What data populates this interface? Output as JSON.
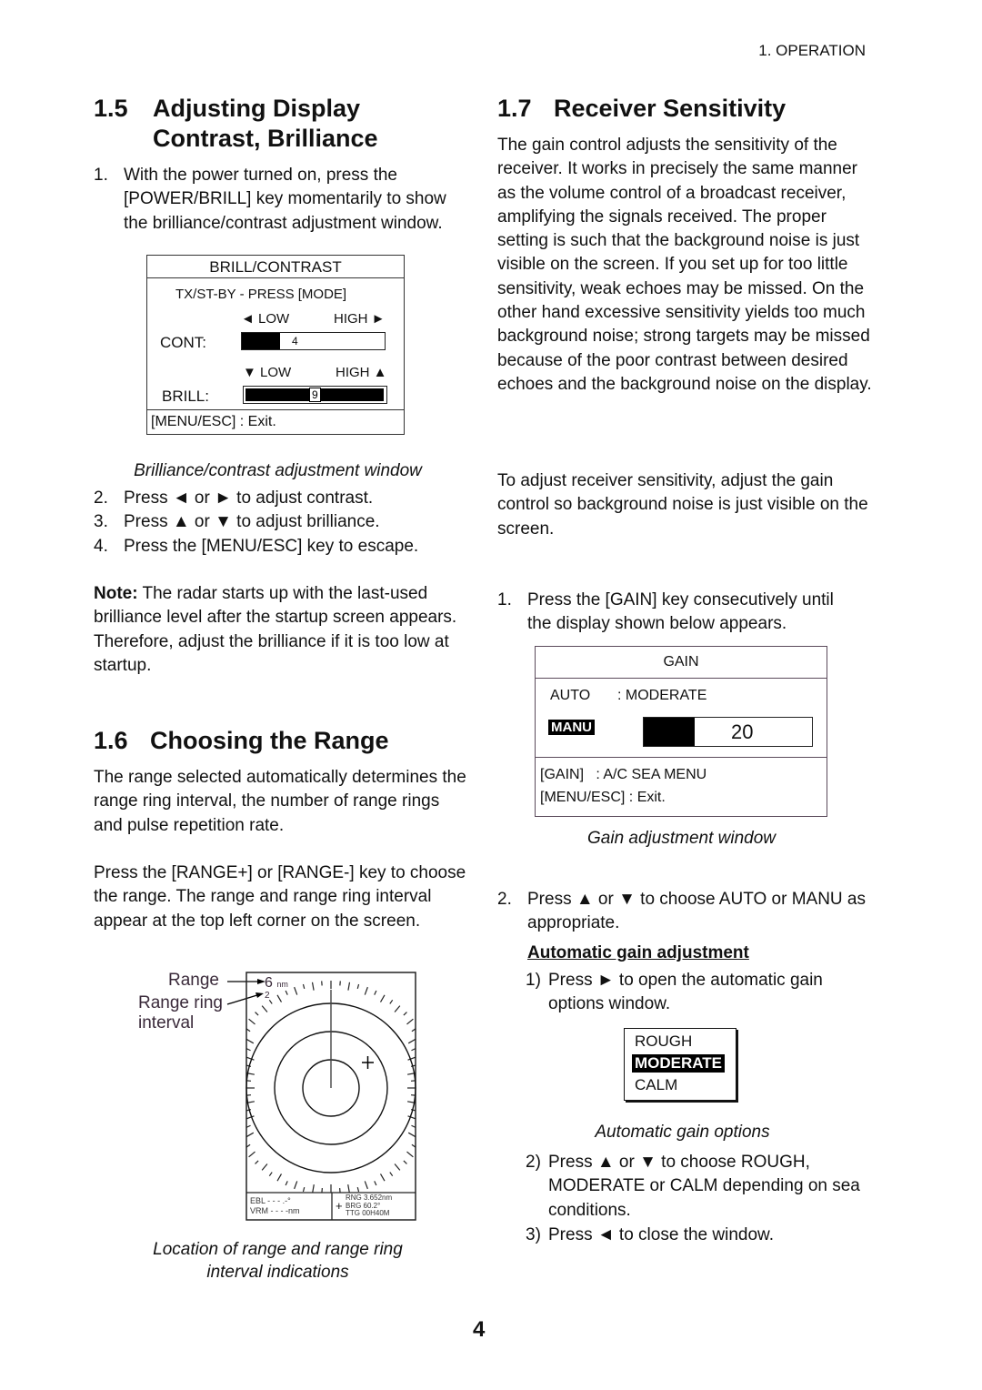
{
  "header": {
    "chapter": "1. OPERATION"
  },
  "page_number": "4",
  "s15": {
    "num": "1.5",
    "title_l1": "Adjusting Display",
    "title_l2": "Contrast, Brilliance",
    "step1": {
      "n": "1.",
      "text": "With the power turned on, press the [POWER/BRILL] key momentarily to show the brilliance/contrast adjustment window."
    },
    "window": {
      "title": "BRILL/CONTRAST",
      "status": "TX/ST-BY - PRESS [MODE]",
      "cont_low": "◄ LOW",
      "cont_high": "HIGH ►",
      "cont_label": "CONT:",
      "cont_value": "4",
      "cont_fraction": 0.27,
      "brill_low": "▼ LOW",
      "brill_high": "HIGH ▲",
      "brill_label": "BRILL:",
      "brill_value": "9",
      "brill_fraction": 1.0,
      "footer": "[MENU/ESC] : Exit."
    },
    "caption": "Brilliance/contrast adjustment window",
    "steps": [
      {
        "n": "2.",
        "text": "Press ◄ or ► to adjust contrast."
      },
      {
        "n": "3.",
        "text": "Press ▲ or ▼ to adjust brilliance."
      },
      {
        "n": "4.",
        "text": "Press the [MENU/ESC] key to escape."
      }
    ],
    "note_label": "Note:",
    "note_text": " The radar starts up with the last-used brilliance level after the startup screen appears. Therefore, adjust the brilliance if it is too low at startup."
  },
  "s16": {
    "num": "1.6",
    "title": "Choosing the Range",
    "para1": "The range selected automatically determines the range ring interval, the number of range rings and pulse repetition rate.",
    "para2": "Press the [RANGE+] or [RANGE-] key to choose the range. The range and range ring interval appear at the top left corner on the screen.",
    "figure": {
      "label_range": "Range",
      "label_ring_l1": "Range ring",
      "label_ring_l2": "interval",
      "range_value": "6",
      "range_unit": "nm",
      "ring_interval": "2",
      "ebl": "EBL - - - .-°",
      "vrm": "VRM - - - -nm",
      "rng": "RNG 3.652nm",
      "brg": "BRG 60.2°",
      "ttg": "TTG 00H40M"
    },
    "caption_l1": "Location of range and range ring",
    "caption_l2": "interval indications"
  },
  "s17": {
    "num": "1.7",
    "title": "Receiver Sensitivity",
    "para1": "The gain control adjusts the sensitivity of the receiver. It works in precisely the same manner as the volume control of a broadcast receiver, amplifying the signals received. The proper setting is such that the background noise is just visible on the screen. If you set up for too little sensitivity, weak echoes may be missed. On the other hand excessive sensitivity yields too much background noise; strong targets may be missed because of the poor contrast between desired echoes and the background noise on the display.",
    "para2": "To adjust receiver sensitivity, adjust the gain control so background noise is just visible on the screen.",
    "step1": {
      "n": "1.",
      "text": "Press the [GAIN] key consecutively until the display shown below appears."
    },
    "gain_window": {
      "title": "GAIN",
      "auto_label": "AUTO",
      "auto_value": ": MODERATE",
      "manu_label": "MANU",
      "manu_value": "20",
      "manu_fraction": 0.3,
      "footer1_key": "[GAIN]",
      "footer1_val": ":  A/C SEA MENU",
      "footer2_key": "[MENU/ESC] :",
      "footer2_val": "Exit."
    },
    "gain_caption": "Gain adjustment window",
    "step2": {
      "n": "2.",
      "text": "Press ▲ or ▼ to choose AUTO or MANU as appropriate."
    },
    "auto_heading": "Automatic gain adjustment",
    "sub1": {
      "n": "1)",
      "text": "Press ► to open the automatic gain options window."
    },
    "options": [
      "ROUGH",
      "MODERATE",
      "CALM"
    ],
    "options_selected": "MODERATE",
    "options_caption": "Automatic gain options",
    "sub2": {
      "n": "2)",
      "text": "Press ▲ or ▼ to choose ROUGH, MODERATE or CALM depending on sea conditions."
    },
    "sub3": {
      "n": "3)",
      "text": "Press ◄ to close the window."
    }
  }
}
